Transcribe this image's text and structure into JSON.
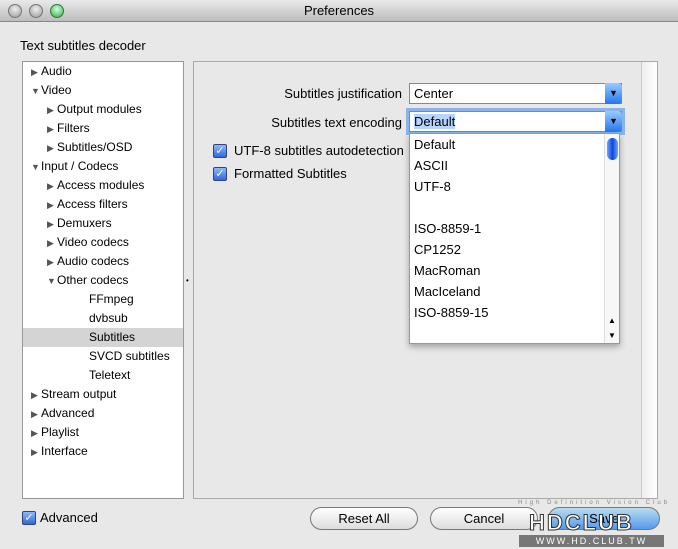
{
  "window": {
    "title": "Preferences"
  },
  "section_title": "Text subtitles decoder",
  "tree": [
    {
      "label": "Audio",
      "level": 0,
      "arrow": "right"
    },
    {
      "label": "Video",
      "level": 0,
      "arrow": "down"
    },
    {
      "label": "Output modules",
      "level": 1,
      "arrow": "right"
    },
    {
      "label": "Filters",
      "level": 1,
      "arrow": "right"
    },
    {
      "label": "Subtitles/OSD",
      "level": 1,
      "arrow": "right"
    },
    {
      "label": "Input / Codecs",
      "level": 0,
      "arrow": "down"
    },
    {
      "label": "Access modules",
      "level": 1,
      "arrow": "right"
    },
    {
      "label": "Access filters",
      "level": 1,
      "arrow": "right"
    },
    {
      "label": "Demuxers",
      "level": 1,
      "arrow": "right"
    },
    {
      "label": "Video codecs",
      "level": 1,
      "arrow": "right"
    },
    {
      "label": "Audio codecs",
      "level": 1,
      "arrow": "right"
    },
    {
      "label": "Other codecs",
      "level": 1,
      "arrow": "down"
    },
    {
      "label": "FFmpeg",
      "level": 2,
      "arrow": ""
    },
    {
      "label": "dvbsub",
      "level": 2,
      "arrow": ""
    },
    {
      "label": "Subtitles",
      "level": 2,
      "arrow": "",
      "selected": true
    },
    {
      "label": "SVCD subtitles",
      "level": 2,
      "arrow": ""
    },
    {
      "label": "Teletext",
      "level": 2,
      "arrow": ""
    },
    {
      "label": "Stream output",
      "level": 0,
      "arrow": "right"
    },
    {
      "label": "Advanced",
      "level": 0,
      "arrow": "right"
    },
    {
      "label": "Playlist",
      "level": 0,
      "arrow": "right"
    },
    {
      "label": "Interface",
      "level": 0,
      "arrow": "right"
    }
  ],
  "settings": {
    "justification_label": "Subtitles justification",
    "justification_value": "Center",
    "encoding_label": "Subtitles text encoding",
    "encoding_value": "Default",
    "utf8_label": "UTF-8 subtitles autodetection",
    "utf8_checked": true,
    "formatted_label": "Formatted Subtitles",
    "formatted_checked": true
  },
  "encoding_options": [
    "Default",
    "ASCII",
    "UTF-8",
    "",
    "ISO-8859-1",
    "CP1252",
    "MacRoman",
    "MacIceland",
    "ISO-8859-15"
  ],
  "footer": {
    "advanced_label": "Advanced",
    "advanced_checked": true,
    "reset_label": "Reset All",
    "cancel_label": "Cancel",
    "save_label": "Save"
  },
  "watermark": {
    "line1": "High Definition Vision Club",
    "logo": "HDCLUB",
    "url": "WWW.HD.CLUB.TW"
  }
}
